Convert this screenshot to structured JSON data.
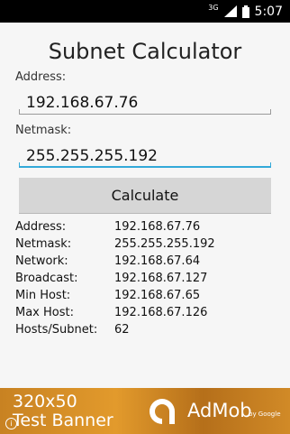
{
  "status": {
    "network": "3G",
    "time": "5:07"
  },
  "app": {
    "title": "Subnet Calculator",
    "address_label": "Address:",
    "address_value": "192.168.67.76",
    "netmask_label": "Netmask:",
    "netmask_value": "255.255.255.192",
    "calculate_label": "Calculate"
  },
  "results": [
    {
      "label": "Address:",
      "value": "192.168.67.76"
    },
    {
      "label": "Netmask:",
      "value": "255.255.255.192"
    },
    {
      "label": "Network:",
      "value": "192.168.67.64"
    },
    {
      "label": "Broadcast:",
      "value": "192.168.67.127"
    },
    {
      "label": "Min Host:",
      "value": "192.168.67.65"
    },
    {
      "label": "Max Host:",
      "value": "192.168.67.126"
    },
    {
      "label": "Hosts/Subnet:",
      "value": "62"
    }
  ],
  "ad": {
    "size_text": "320x50",
    "banner_text": "Test Banner",
    "brand": "AdMob",
    "by_google": "by Google",
    "info_icon": "i"
  },
  "colors": {
    "accent": "#33a9d9",
    "statusbar": "#000000",
    "button": "#d6d6d6",
    "ad_bg": "#d98c24"
  }
}
